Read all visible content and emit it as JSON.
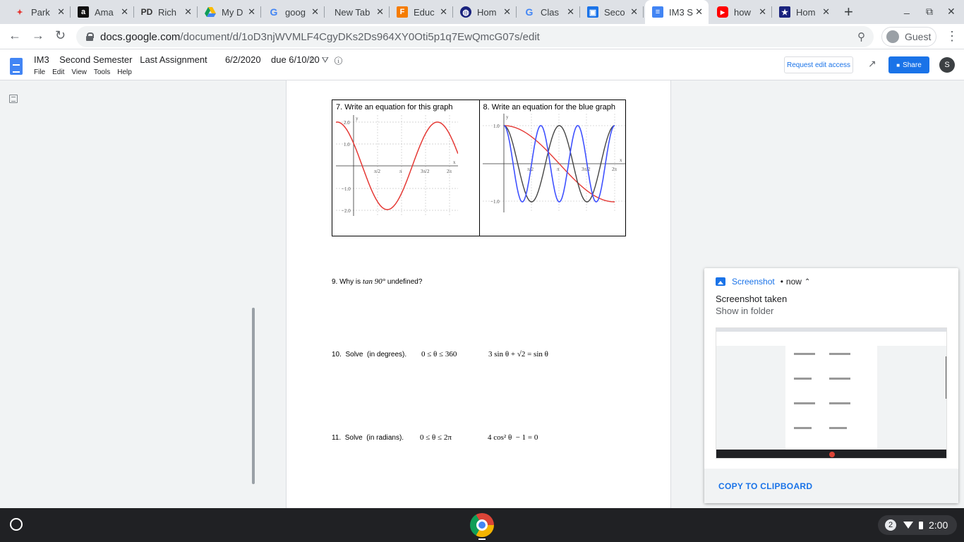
{
  "browser": {
    "tabs": [
      {
        "label": "Park",
        "icon": "park-favicon",
        "active": false
      },
      {
        "label": "Ama",
        "icon": "amazon-favicon",
        "active": false
      },
      {
        "label": "Rich",
        "icon": "pd-favicon",
        "active": false
      },
      {
        "label": "My D",
        "icon": "google-drive-favicon",
        "active": false
      },
      {
        "label": "goog",
        "icon": "google-favicon",
        "active": false
      },
      {
        "label": "New Tab",
        "icon": "",
        "active": false
      },
      {
        "label": "Educ",
        "icon": "educ-favicon",
        "active": false
      },
      {
        "label": "Hom",
        "icon": "home-favicon",
        "active": false
      },
      {
        "label": "Clas",
        "icon": "google-favicon",
        "active": false
      },
      {
        "label": "Seco",
        "icon": "classroom-favicon",
        "active": false
      },
      {
        "label": "IM3 S",
        "icon": "google-docs-favicon",
        "active": true
      },
      {
        "label": "how",
        "icon": "youtube-favicon",
        "active": false
      },
      {
        "label": "Hom",
        "icon": "home-star-favicon",
        "active": false
      }
    ],
    "url_host": "docs.google.com",
    "url_path": "/document/d/1oD3njWVMLF4CgyDKs2Ds964XY0Oti5p1q7EwQmcG07s/edit",
    "profile_label": "Guest"
  },
  "docs": {
    "title": "IM3    Second Semester   Last Assignment       6/2/2020    due 6/10/20",
    "menu": [
      "File",
      "Edit",
      "View",
      "Tools",
      "Help"
    ],
    "request_edit_label": "Request edit access",
    "share_label": "Share",
    "user_initial": "S"
  },
  "document": {
    "q7_title": "7.  Write an equation for this graph",
    "q8_title": "8.  Write an equation for the blue graph",
    "q9_prefix": "9. Why is ",
    "q9_math": "tan 90°",
    "q9_suffix": " undefined?",
    "q10_label": "10.  Solve  (in degrees).",
    "q10_domain": "0 ≤ θ ≤ 360",
    "q10_equation": "3 sin θ + √2 = sin θ",
    "q11_label": "11.  Solve  (in radians).",
    "q11_domain": "0 ≤ θ ≤ 2π",
    "q11_equation": "4 cos² θ  − 1 = 0",
    "graph7": {
      "y_ticks": [
        "2.0",
        "1.0",
        "−1.0",
        "−2.0"
      ],
      "x_ticks": [
        "π/2",
        "π",
        "3π/2",
        "2π"
      ],
      "y_axis_symbol": "y",
      "x_axis_symbol": "x",
      "color": "#e53935"
    },
    "graph8": {
      "y_ticks": [
        "1.0",
        "−1.0"
      ],
      "x_ticks": [
        "π/2",
        "π",
        "3π/2",
        "2π"
      ],
      "y_axis_symbol": "y",
      "x_axis_symbol": "x",
      "colors": {
        "blue": "#3f51ff",
        "black": "#444444",
        "red": "#e53935"
      }
    }
  },
  "notification": {
    "app": "Screenshot",
    "time": "now",
    "title": "Screenshot taken",
    "subtitle": "Show in folder",
    "action_label": "COPY TO CLIPBOARD"
  },
  "taskbar": {
    "notification_count": "2",
    "time": "2:00"
  }
}
